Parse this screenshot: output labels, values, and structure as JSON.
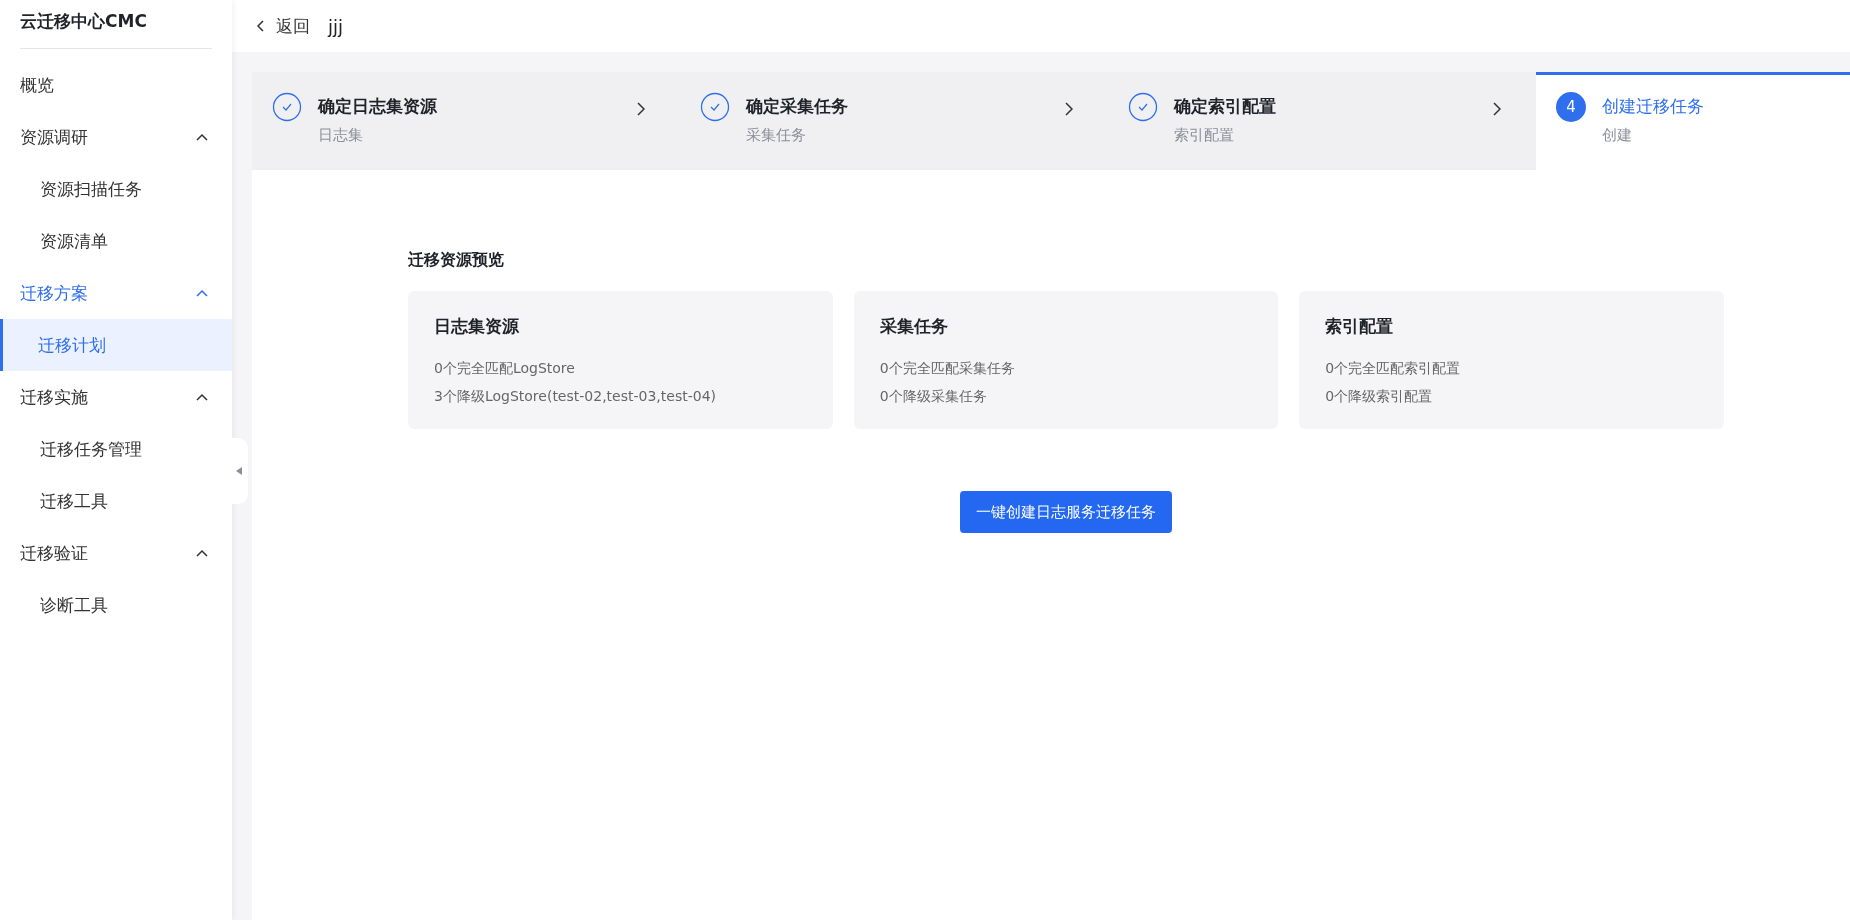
{
  "sidebar": {
    "title": "云迁移中心CMC",
    "items": [
      {
        "label": "概览",
        "selected": false
      },
      {
        "label": "资源调研",
        "selected": false,
        "expanded": true,
        "children": [
          {
            "label": "资源扫描任务",
            "selected": false
          },
          {
            "label": "资源清单",
            "selected": false
          }
        ]
      },
      {
        "label": "迁移方案",
        "selected": true,
        "expanded": true,
        "children": [
          {
            "label": "迁移计划",
            "selected": true
          }
        ]
      },
      {
        "label": "迁移实施",
        "selected": false,
        "expanded": true,
        "children": [
          {
            "label": "迁移任务管理",
            "selected": false
          },
          {
            "label": "迁移工具",
            "selected": false
          }
        ]
      },
      {
        "label": "迁移验证",
        "selected": false,
        "expanded": true,
        "children": [
          {
            "label": "诊断工具",
            "selected": false
          }
        ]
      }
    ]
  },
  "header": {
    "back": "返回",
    "title": "jjj"
  },
  "steps": [
    {
      "title": "确定日志集资源",
      "subtitle": "日志集",
      "completed": true,
      "selected": false
    },
    {
      "title": "确定采集任务",
      "subtitle": "采集任务",
      "completed": true,
      "selected": false
    },
    {
      "title": "确定索引配置",
      "subtitle": "索引配置",
      "completed": true,
      "selected": false
    },
    {
      "title": "创建迁移任务",
      "subtitle": "创建",
      "completed": false,
      "selected": true,
      "number": "4"
    }
  ],
  "preview": {
    "heading": "迁移资源预览",
    "cards": [
      {
        "title": "日志集资源",
        "lines": [
          "0个完全匹配LogStore",
          "3个降级LogStore(test-02,test-03,test-04)"
        ]
      },
      {
        "title": "采集任务",
        "lines": [
          "0个完全匹配采集任务",
          "0个降级采集任务"
        ]
      },
      {
        "title": "索引配置",
        "lines": [
          "0个完全匹配索引配置",
          "0个降级索引配置"
        ]
      }
    ]
  },
  "create_button": "一键创建日志服务迁移任务"
}
